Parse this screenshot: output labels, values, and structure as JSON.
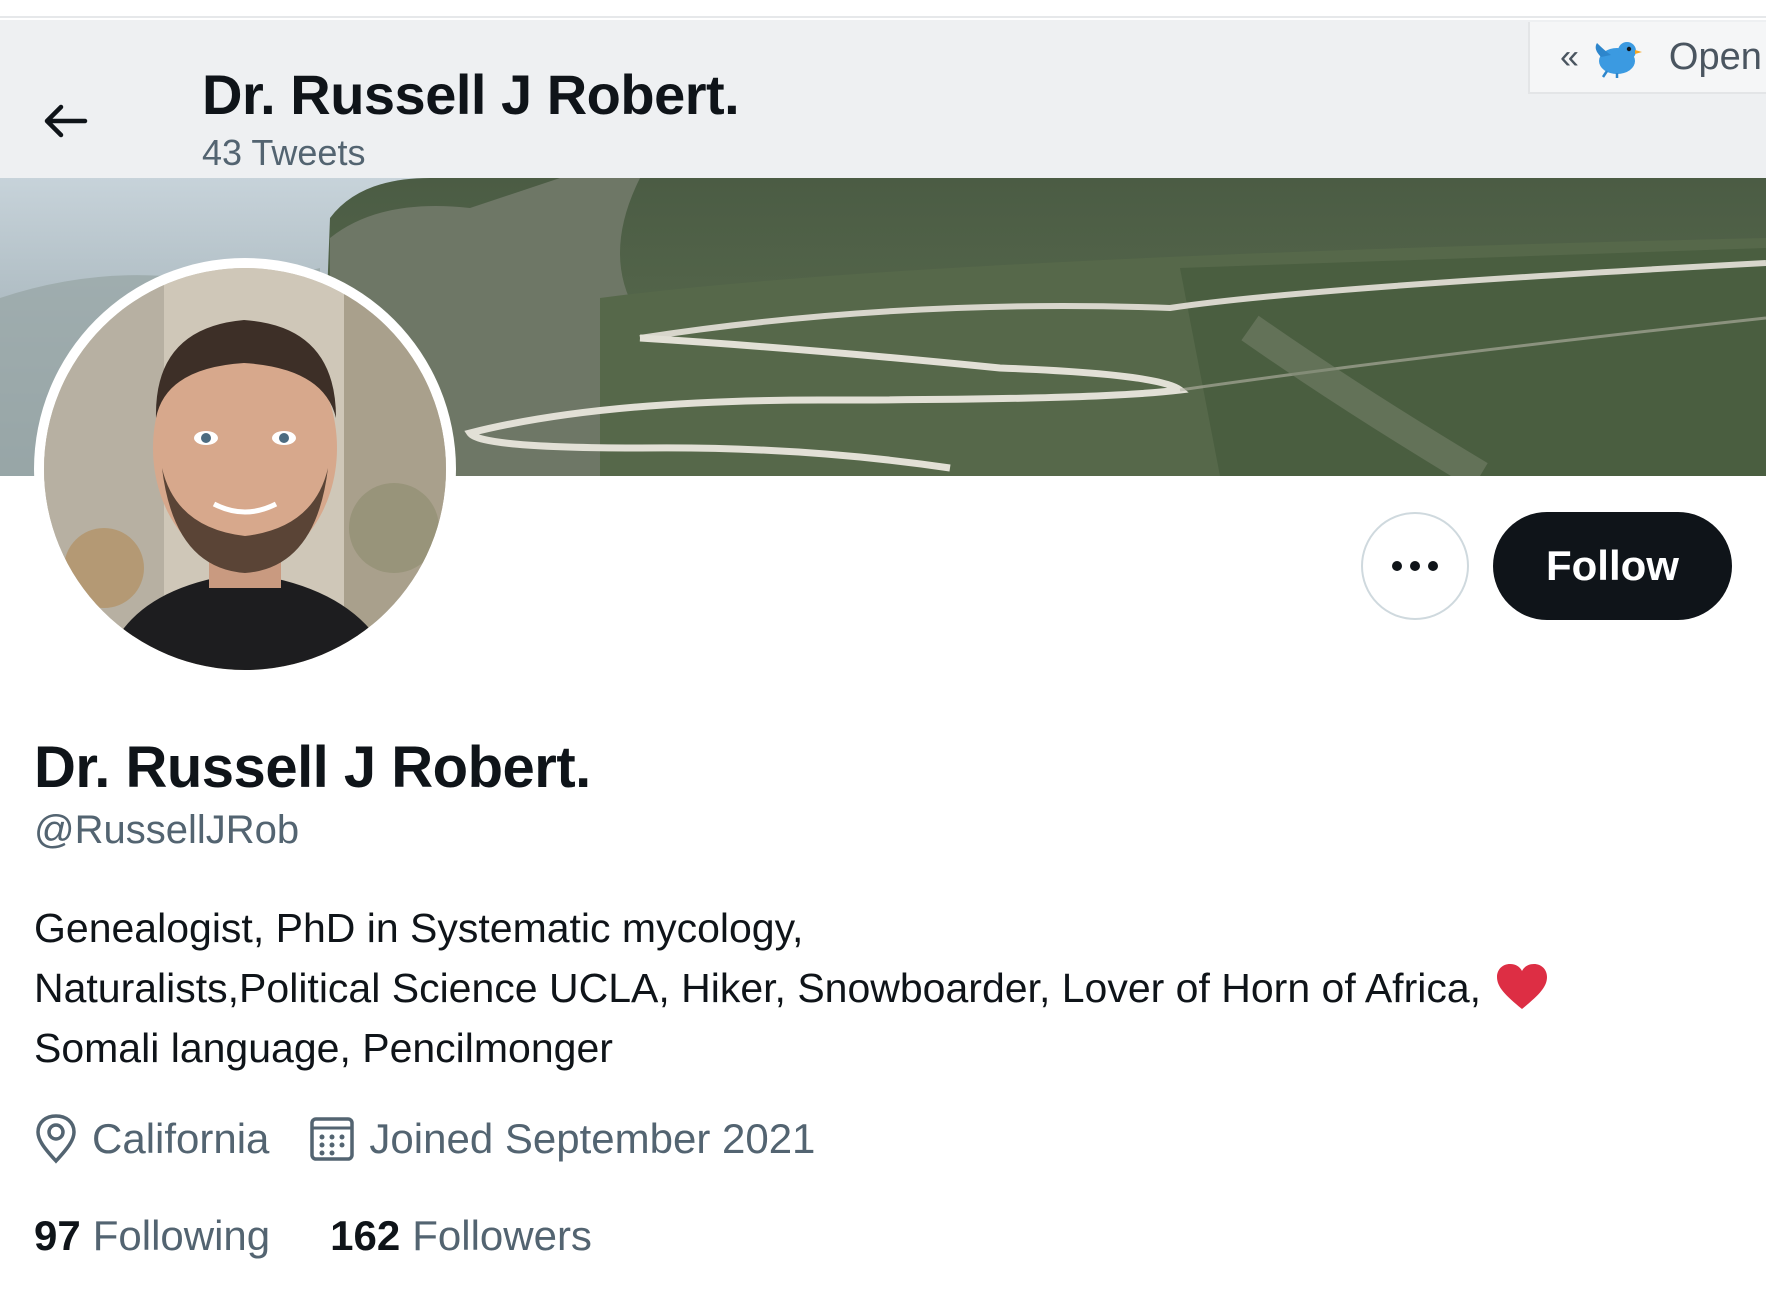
{
  "header": {
    "back_icon": "arrow-left-icon",
    "title": "Dr. Russell J Robert.",
    "tweets_count": "43 Tweets"
  },
  "extension": {
    "chevron": "«",
    "bird_icon": "bird-icon",
    "label": "Open"
  },
  "profile": {
    "name": "Dr. Russell J Robert.",
    "handle": "@RussellJRob",
    "bio_lines": [
      "Genealogist, PhD in Systematic mycology,",
      "Naturalists,Political Science UCLA, Hiker, Snowboarder, Lover of Horn of Africa,",
      "Somali language, Pencilmonger"
    ],
    "location": "California",
    "joined": "Joined September 2021",
    "following_count": "97",
    "following_label": "Following",
    "followers_count": "162",
    "followers_label": "Followers"
  },
  "actions": {
    "more_icon": "more-dots-icon",
    "follow_label": "Follow"
  },
  "colors": {
    "primary_text": "#0f1419",
    "secondary_text": "#536471",
    "follow_bg": "#0f1419",
    "heart": "#e0245e",
    "header_bg": "#eef0f2"
  }
}
